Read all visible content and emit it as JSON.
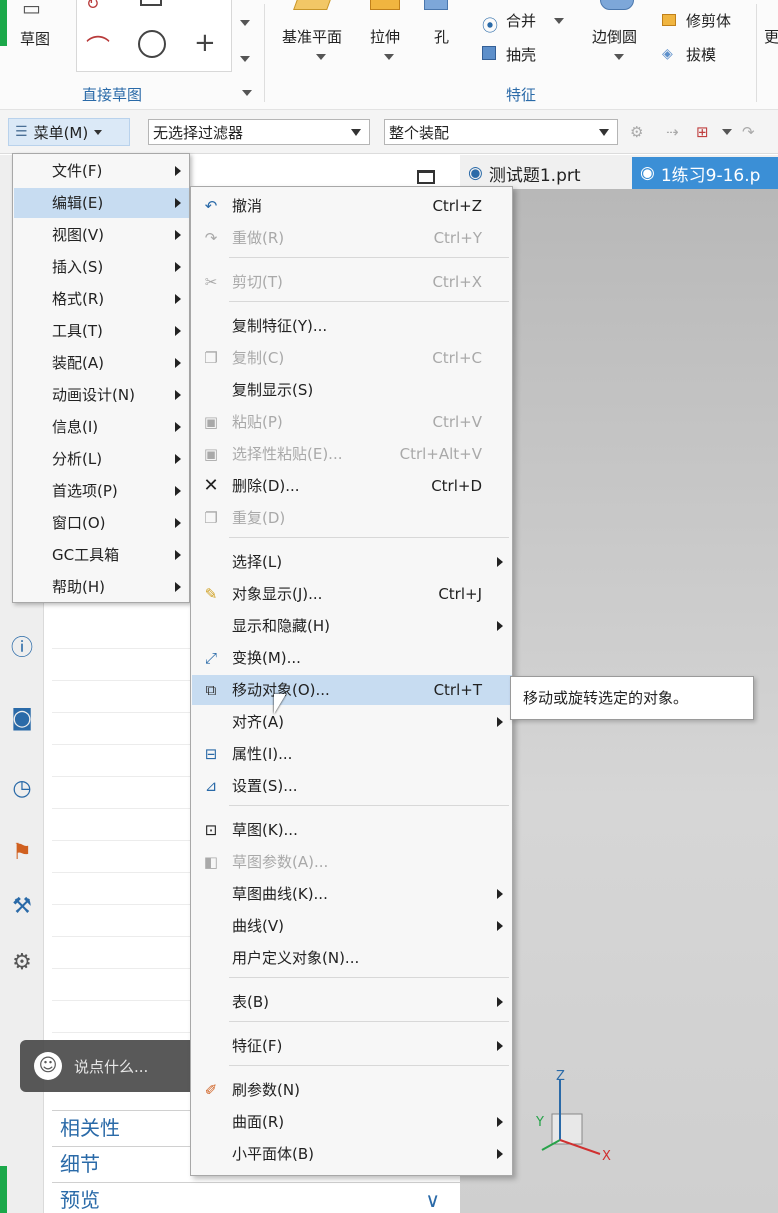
{
  "ribbon": {
    "sketch_label": "草图",
    "direct_sketch_group": "直接草图",
    "datum_plane": "基准平面",
    "extrude": "拉伸",
    "hole": "孔",
    "unite": "合并",
    "shell": "抽壳",
    "edge_blend": "边倒圆",
    "trim_body": "修剪体",
    "draft": "拔模",
    "more": "更",
    "feature_group": "特征"
  },
  "toolbar": {
    "menu_label": "菜单(M)",
    "filter_value": "无选择过滤器",
    "scope_value": "整个装配"
  },
  "tabs": [
    {
      "label": "测试题1.prt"
    },
    {
      "label": "1练习9-16.p"
    }
  ],
  "main_menu": [
    {
      "label": "文件(F)"
    },
    {
      "label": "编辑(E)"
    },
    {
      "label": "视图(V)"
    },
    {
      "label": "插入(S)"
    },
    {
      "label": "格式(R)"
    },
    {
      "label": "工具(T)"
    },
    {
      "label": "装配(A)"
    },
    {
      "label": "动画设计(N)"
    },
    {
      "label": "信息(I)"
    },
    {
      "label": "分析(L)"
    },
    {
      "label": "首选项(P)"
    },
    {
      "label": "窗口(O)"
    },
    {
      "label": "GC工具箱"
    },
    {
      "label": "帮助(H)"
    }
  ],
  "edit_menu": [
    {
      "label": "撤消",
      "shortcut": "Ctrl+Z"
    },
    {
      "label": "重做(R)",
      "shortcut": "Ctrl+Y"
    },
    {
      "label": "剪切(T)",
      "shortcut": "Ctrl+X"
    },
    {
      "label": "复制特征(Y)...",
      "shortcut": ""
    },
    {
      "label": "复制(C)",
      "shortcut": "Ctrl+C"
    },
    {
      "label": "复制显示(S)",
      "shortcut": ""
    },
    {
      "label": "粘贴(P)",
      "shortcut": "Ctrl+V"
    },
    {
      "label": "选择性粘贴(E)...",
      "shortcut": "Ctrl+Alt+V"
    },
    {
      "label": "删除(D)...",
      "shortcut": "Ctrl+D"
    },
    {
      "label": "重复(D)",
      "shortcut": ""
    },
    {
      "label": "选择(L)",
      "shortcut": ""
    },
    {
      "label": "对象显示(J)...",
      "shortcut": "Ctrl+J"
    },
    {
      "label": "显示和隐藏(H)",
      "shortcut": ""
    },
    {
      "label": "变换(M)...",
      "shortcut": ""
    },
    {
      "label": "移动对象(O)...",
      "shortcut": "Ctrl+T"
    },
    {
      "label": "对齐(A)",
      "shortcut": ""
    },
    {
      "label": "属性(I)...",
      "shortcut": ""
    },
    {
      "label": "设置(S)...",
      "shortcut": ""
    },
    {
      "label": "草图(K)...",
      "shortcut": ""
    },
    {
      "label": "草图参数(A)...",
      "shortcut": ""
    },
    {
      "label": "草图曲线(K)...",
      "shortcut": ""
    },
    {
      "label": "曲线(V)",
      "shortcut": ""
    },
    {
      "label": "用户定义对象(N)...",
      "shortcut": ""
    },
    {
      "label": "表(B)",
      "shortcut": ""
    },
    {
      "label": "特征(F)",
      "shortcut": ""
    },
    {
      "label": "刷参数(N)",
      "shortcut": ""
    },
    {
      "label": "曲面(R)",
      "shortcut": ""
    },
    {
      "label": "小平面体(B)",
      "shortcut": ""
    }
  ],
  "tooltip": "移动或旋转选定的对象。",
  "navigator": {
    "dependencies": "相关性",
    "details": "细节",
    "preview": "预览"
  },
  "chat_placeholder": "说点什么...",
  "axes": {
    "z": "Z",
    "y": "Y",
    "x": "X"
  },
  "colors": {
    "menu_highlight": "#c7dcf1",
    "brand_green": "#1ba84a",
    "group_label_blue": "#2a6aa8",
    "disabled_text": "#a9a9a9"
  }
}
